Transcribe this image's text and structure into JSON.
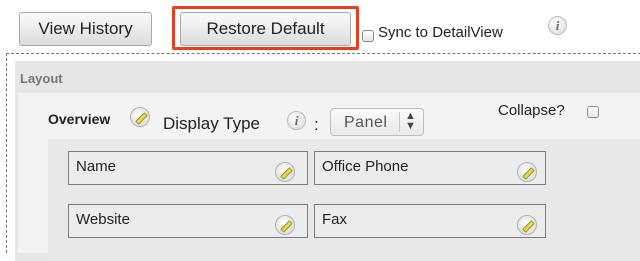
{
  "toolbar": {
    "view_history_label": "View History",
    "restore_default_label": "Restore Default",
    "sync_label": "Sync to DetailView",
    "sync_checked": false,
    "highlight_color": "#e2401f"
  },
  "layout": {
    "heading": "Layout",
    "panel": {
      "title": "Overview",
      "display_type_label": "Display Type",
      "colon": ":",
      "display_type_value": "Panel",
      "collapse_label": "Collapse?",
      "collapse_checked": false
    },
    "fields": [
      {
        "label": "Name"
      },
      {
        "label": "Office Phone"
      },
      {
        "label": "Website"
      },
      {
        "label": "Fax"
      }
    ]
  },
  "icons": {
    "info": "i",
    "edit": "pencil-icon",
    "select_arrows": "up-down-arrows"
  }
}
